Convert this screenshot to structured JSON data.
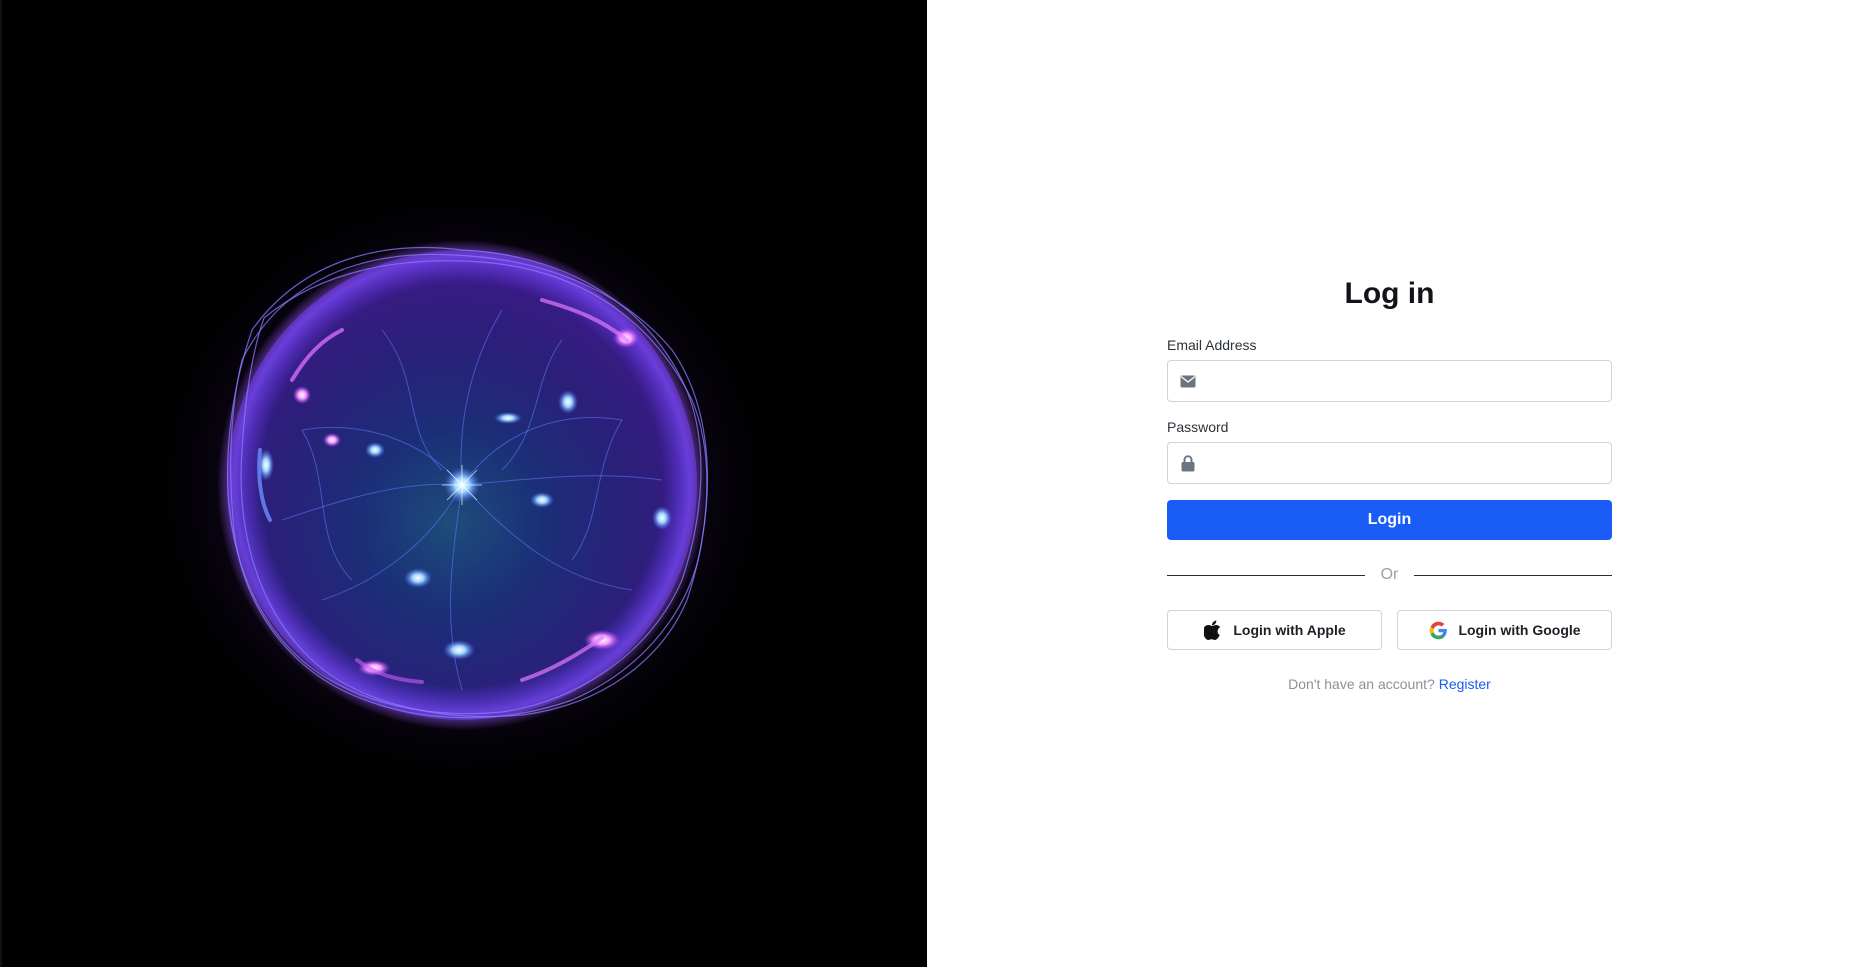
{
  "form": {
    "title": "Log in",
    "email_label": "Email Address",
    "email_value": "",
    "email_placeholder": "",
    "password_label": "Password",
    "password_value": "",
    "password_placeholder": "",
    "login_label": "Login",
    "divider_text": "Or",
    "apple_label": "Login with Apple",
    "google_label": "Login with Google",
    "register_prompt": "Don't have an account?",
    "register_link": "Register"
  },
  "icons": {
    "email": "envelope-icon",
    "password": "lock-icon",
    "apple": "apple-logo-icon",
    "google": "google-logo-icon"
  },
  "colors": {
    "primary": "#1a5cf6",
    "hero_background": "#000000",
    "orb_core": "#5a3cff",
    "orb_glow": "#c040ff"
  }
}
